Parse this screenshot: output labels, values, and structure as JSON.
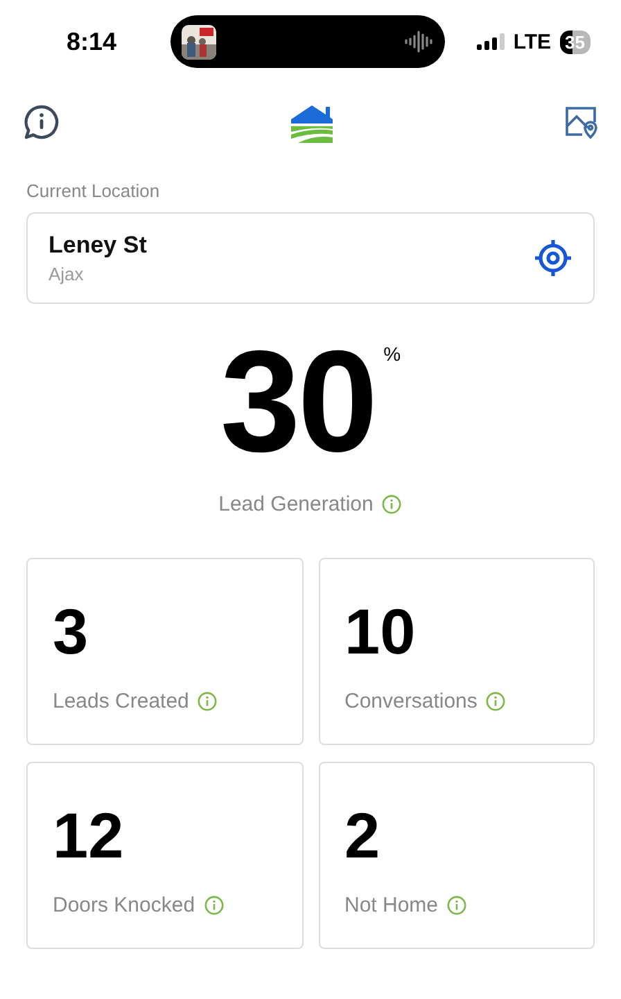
{
  "status_bar": {
    "time": "8:14",
    "network": "LTE",
    "battery": "35"
  },
  "location": {
    "label": "Current Location",
    "street": "Leney St",
    "city": "Ajax"
  },
  "headline": {
    "value": "30",
    "unit": "%",
    "label": "Lead Generation"
  },
  "stats": [
    {
      "value": "3",
      "label": "Leads Created"
    },
    {
      "value": "10",
      "label": "Conversations"
    },
    {
      "value": "12",
      "label": "Doors Knocked"
    },
    {
      "value": "2",
      "label": "Not Home"
    }
  ]
}
